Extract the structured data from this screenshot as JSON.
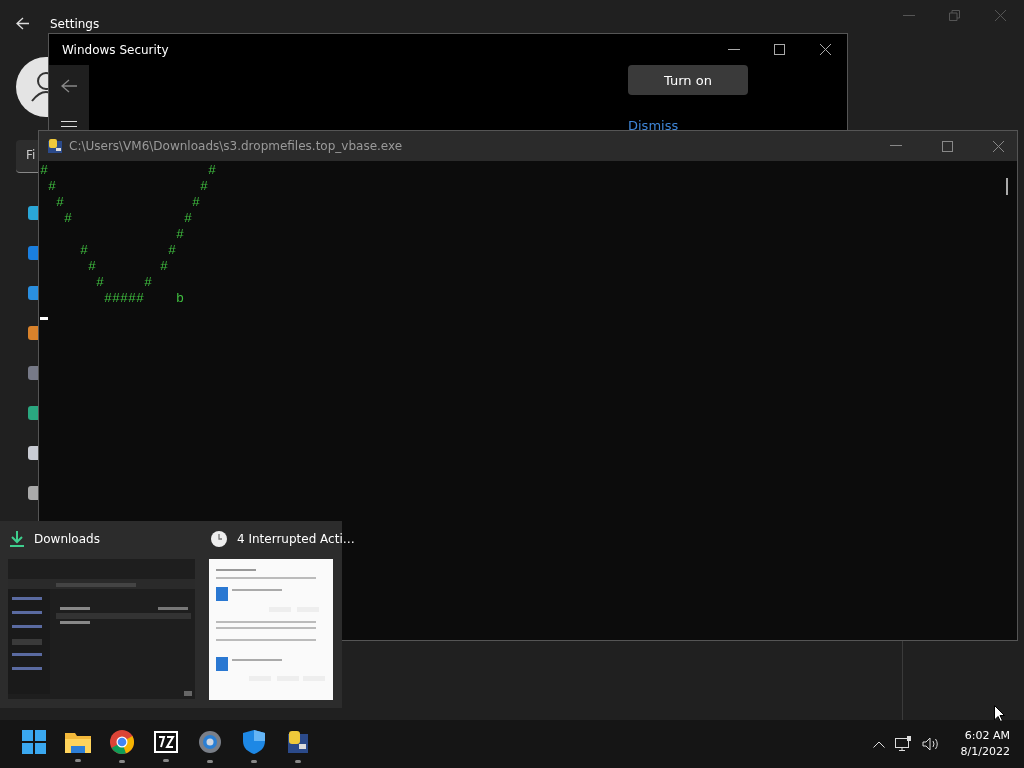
{
  "settings_window": {
    "title": "Settings",
    "search_placeholder": "Fi"
  },
  "security_window": {
    "title": "Windows Security",
    "button": "Turn on",
    "link": "Dismiss"
  },
  "console_window": {
    "title": "C:\\Users\\VM6\\Downloads\\s3.dropmefiles.top_vbase.exe",
    "lines": [
      "#                    #",
      " #                  #",
      "  #                #",
      "   #              #",
      "                 #",
      "     #          #",
      "      #        #",
      "       #     #",
      "        #####    b"
    ]
  },
  "taskbar_preview": {
    "items": [
      {
        "kind": "download",
        "title": "Downloads"
      },
      {
        "kind": "clock",
        "title": "4 Interrupted Acti…"
      }
    ]
  },
  "taskbar": {
    "apps": [
      {
        "kind": "start",
        "running": false
      },
      {
        "kind": "folder",
        "running": true
      },
      {
        "kind": "browser",
        "running": true
      },
      {
        "kind": "archiver",
        "running": true
      },
      {
        "kind": "settings",
        "running": true
      },
      {
        "kind": "shield",
        "running": true
      },
      {
        "kind": "console",
        "running": true
      }
    ],
    "time": "6:02 AM",
    "date": "8/1/2022"
  }
}
